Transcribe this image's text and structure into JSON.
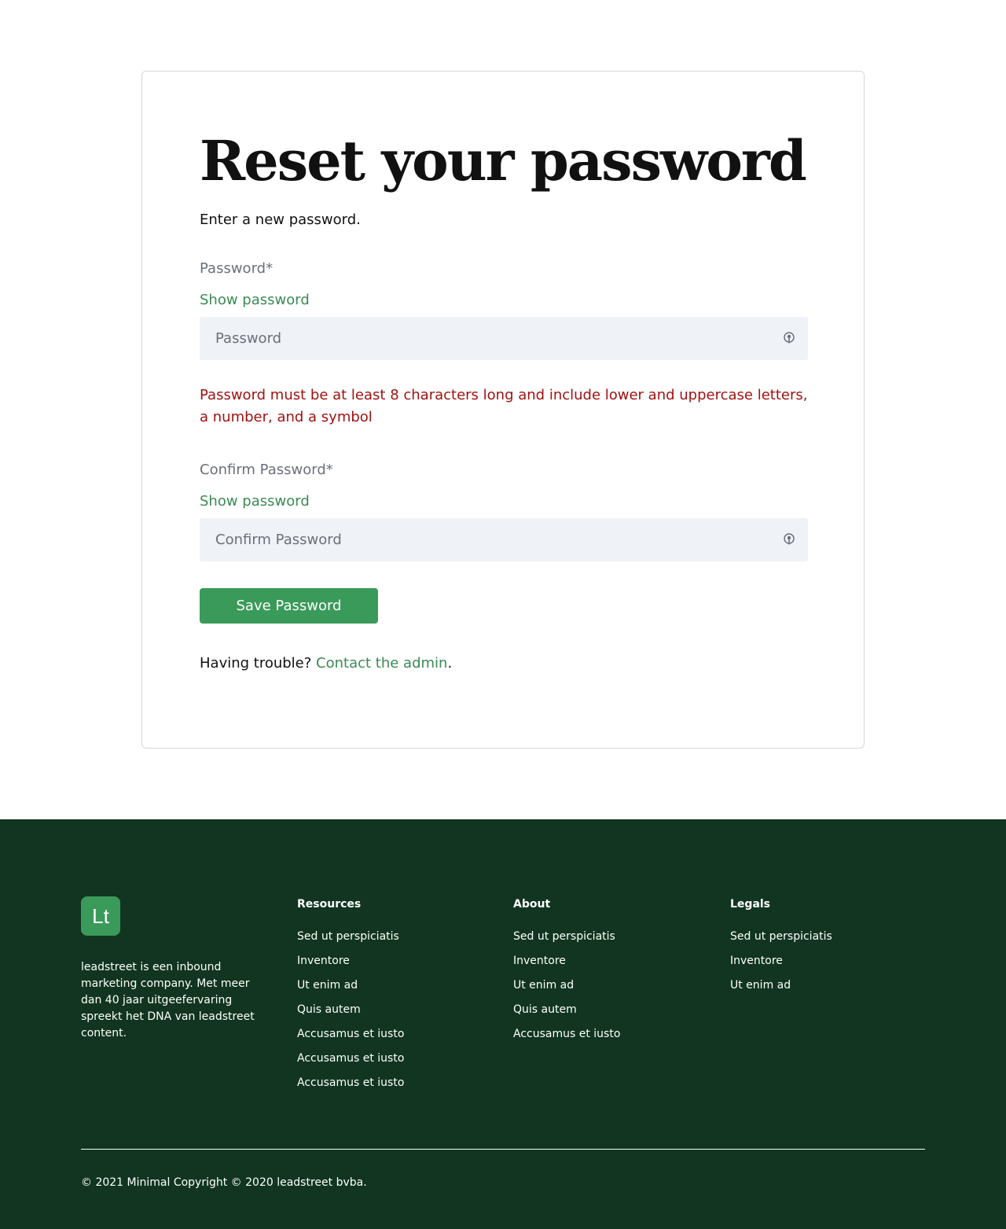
{
  "form": {
    "title": "Reset your password",
    "subtitle": "Enter a new password.",
    "password_label": "Password*",
    "show_password": "Show password",
    "password_placeholder": "Password",
    "error": "Password must be at least 8 characters long and include lower and uppercase letters, a number, and a symbol",
    "confirm_label": "Confirm Password*",
    "confirm_show_password": "Show password",
    "confirm_placeholder": "Confirm Password",
    "save_label": "Save Password",
    "trouble_text": "Having trouble?",
    "trouble_link": "Contact the admin",
    "trouble_end": "."
  },
  "icons": {
    "password_field": "key-icon",
    "confirm_field": "key-icon"
  },
  "colors": {
    "accent": "#3a9a5a",
    "link": "#3a8a55",
    "error": "#a01212",
    "footer_bg": "#113520",
    "input_bg": "#eff2f6"
  },
  "footer": {
    "logo": "Lt",
    "about": "leadstreet is een inbound marketing company. Met meer dan 40 jaar uitgeefervaring spreekt het DNA van leadstreet content.",
    "columns": [
      {
        "heading": "Resources",
        "items": [
          "Sed ut perspiciatis",
          "Inventore",
          "Ut enim ad",
          "Quis autem",
          "Accusamus et iusto",
          "Accusamus et iusto",
          "Accusamus et iusto"
        ]
      },
      {
        "heading": "About",
        "items": [
          "Sed ut perspiciatis",
          "Inventore",
          "Ut enim ad",
          "Quis autem",
          "Accusamus et iusto"
        ]
      },
      {
        "heading": "Legals",
        "items": [
          "Sed ut perspiciatis",
          "Inventore",
          "Ut enim ad"
        ]
      }
    ],
    "copyright": "© 2021 Minimal Copyright © 2020 leadstreet bvba."
  }
}
